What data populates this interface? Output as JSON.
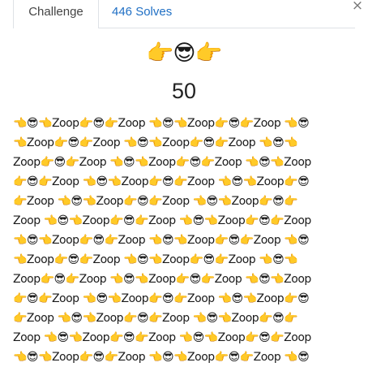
{
  "tabs": {
    "challenge": "Challenge",
    "solves": "446 Solves"
  },
  "close_glyph": "×",
  "challenge": {
    "title": "👉😎👉",
    "value": "50",
    "description_lines": [
      "👈😎👈Zoop👉😎👉Zoop 👈😎👈Zoop👉😎👉Zoop 👈😎",
      "👈Zoop👉😎👉Zoop 👈😎👈Zoop👉😎👉Zoop 👈😎👈",
      "Zoop👉😎👉Zoop 👈😎👈Zoop👉😎👉Zoop 👈😎👈Zoop",
      "👉😎👉Zoop 👈😎👈Zoop👉😎👉Zoop 👈😎👈Zoop👉😎",
      "👉Zoop 👈😎👈Zoop👉😎👉Zoop 👈😎👈Zoop👉😎👉",
      "Zoop 👈😎👈Zoop👉😎👉Zoop 👈😎👈Zoop👉😎👉Zoop",
      "👈😎👈Zoop👉😎👉Zoop 👈😎👈Zoop👉😎👉Zoop 👈😎",
      "👈Zoop👉😎👉Zoop 👈😎👈Zoop👉😎👉Zoop 👈😎👈",
      "Zoop👉😎👉Zoop 👈😎👈Zoop👉😎👉Zoop 👈😎👈Zoop",
      "👉😎👉Zoop 👈😎👈Zoop👉😎👉Zoop 👈😎👈Zoop👉😎",
      "👉Zoop 👈😎👈Zoop👉😎👉Zoop 👈😎👈Zoop👉😎👉",
      "Zoop 👈😎👈Zoop👉😎👉Zoop 👈😎👈Zoop👉😎👉Zoop",
      "👈😎👈Zoop👉😎👉Zoop 👈😎👈Zoop👉😎👉Zoop 👈😎"
    ]
  },
  "colors": {
    "link": "#1f6fc4",
    "border": "#dee2e6"
  }
}
